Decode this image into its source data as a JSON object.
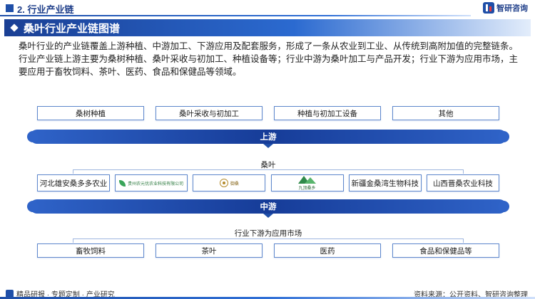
{
  "header": {
    "section_title": "2. 行业产业链",
    "brand": "智研咨询"
  },
  "band": {
    "title": "桑叶行业产业链图谱"
  },
  "description": "桑叶行业的产业链覆盖上游种植、中游加工、下游应用及配套服务，形成了一条从农业到工业、从传统到高附加值的完整链条。行业产业链上游主要为桑树种植、桑叶采收与初加工、种植设备等；行业中游为桑叶加工与产品开发；行业下游为应用市场，主要应用于畜牧饲料、茶叶、医药、食品和保健品等领域。",
  "upstream": {
    "items": [
      "桑树种植",
      "桑叶采收与初加工",
      "种植与初加工设备",
      "其他"
    ],
    "label": "上游"
  },
  "midstream": {
    "category": "桑叶",
    "companies": [
      {
        "name": "河北雄安桑多多农业",
        "type": "text"
      },
      {
        "name": "贵州农元优农业科技有限公司",
        "type": "logo-leaf"
      },
      {
        "name": "御桑",
        "type": "logo-seal"
      },
      {
        "name": "九顶桑乡",
        "type": "logo-mountain"
      },
      {
        "name": "新疆金桑湾生物科技",
        "type": "text"
      },
      {
        "name": "山西晋桑农业科技",
        "type": "text"
      }
    ],
    "label": "中游"
  },
  "downstream": {
    "label": "行业下游为应用市场",
    "items": [
      "畜牧饲料",
      "茶叶",
      "医药",
      "食品和保健品等"
    ]
  },
  "footer": {
    "left": "精品研报 · 专题定制 · 产业研究",
    "right": "资料来源：公开资料、智研咨询整理"
  }
}
